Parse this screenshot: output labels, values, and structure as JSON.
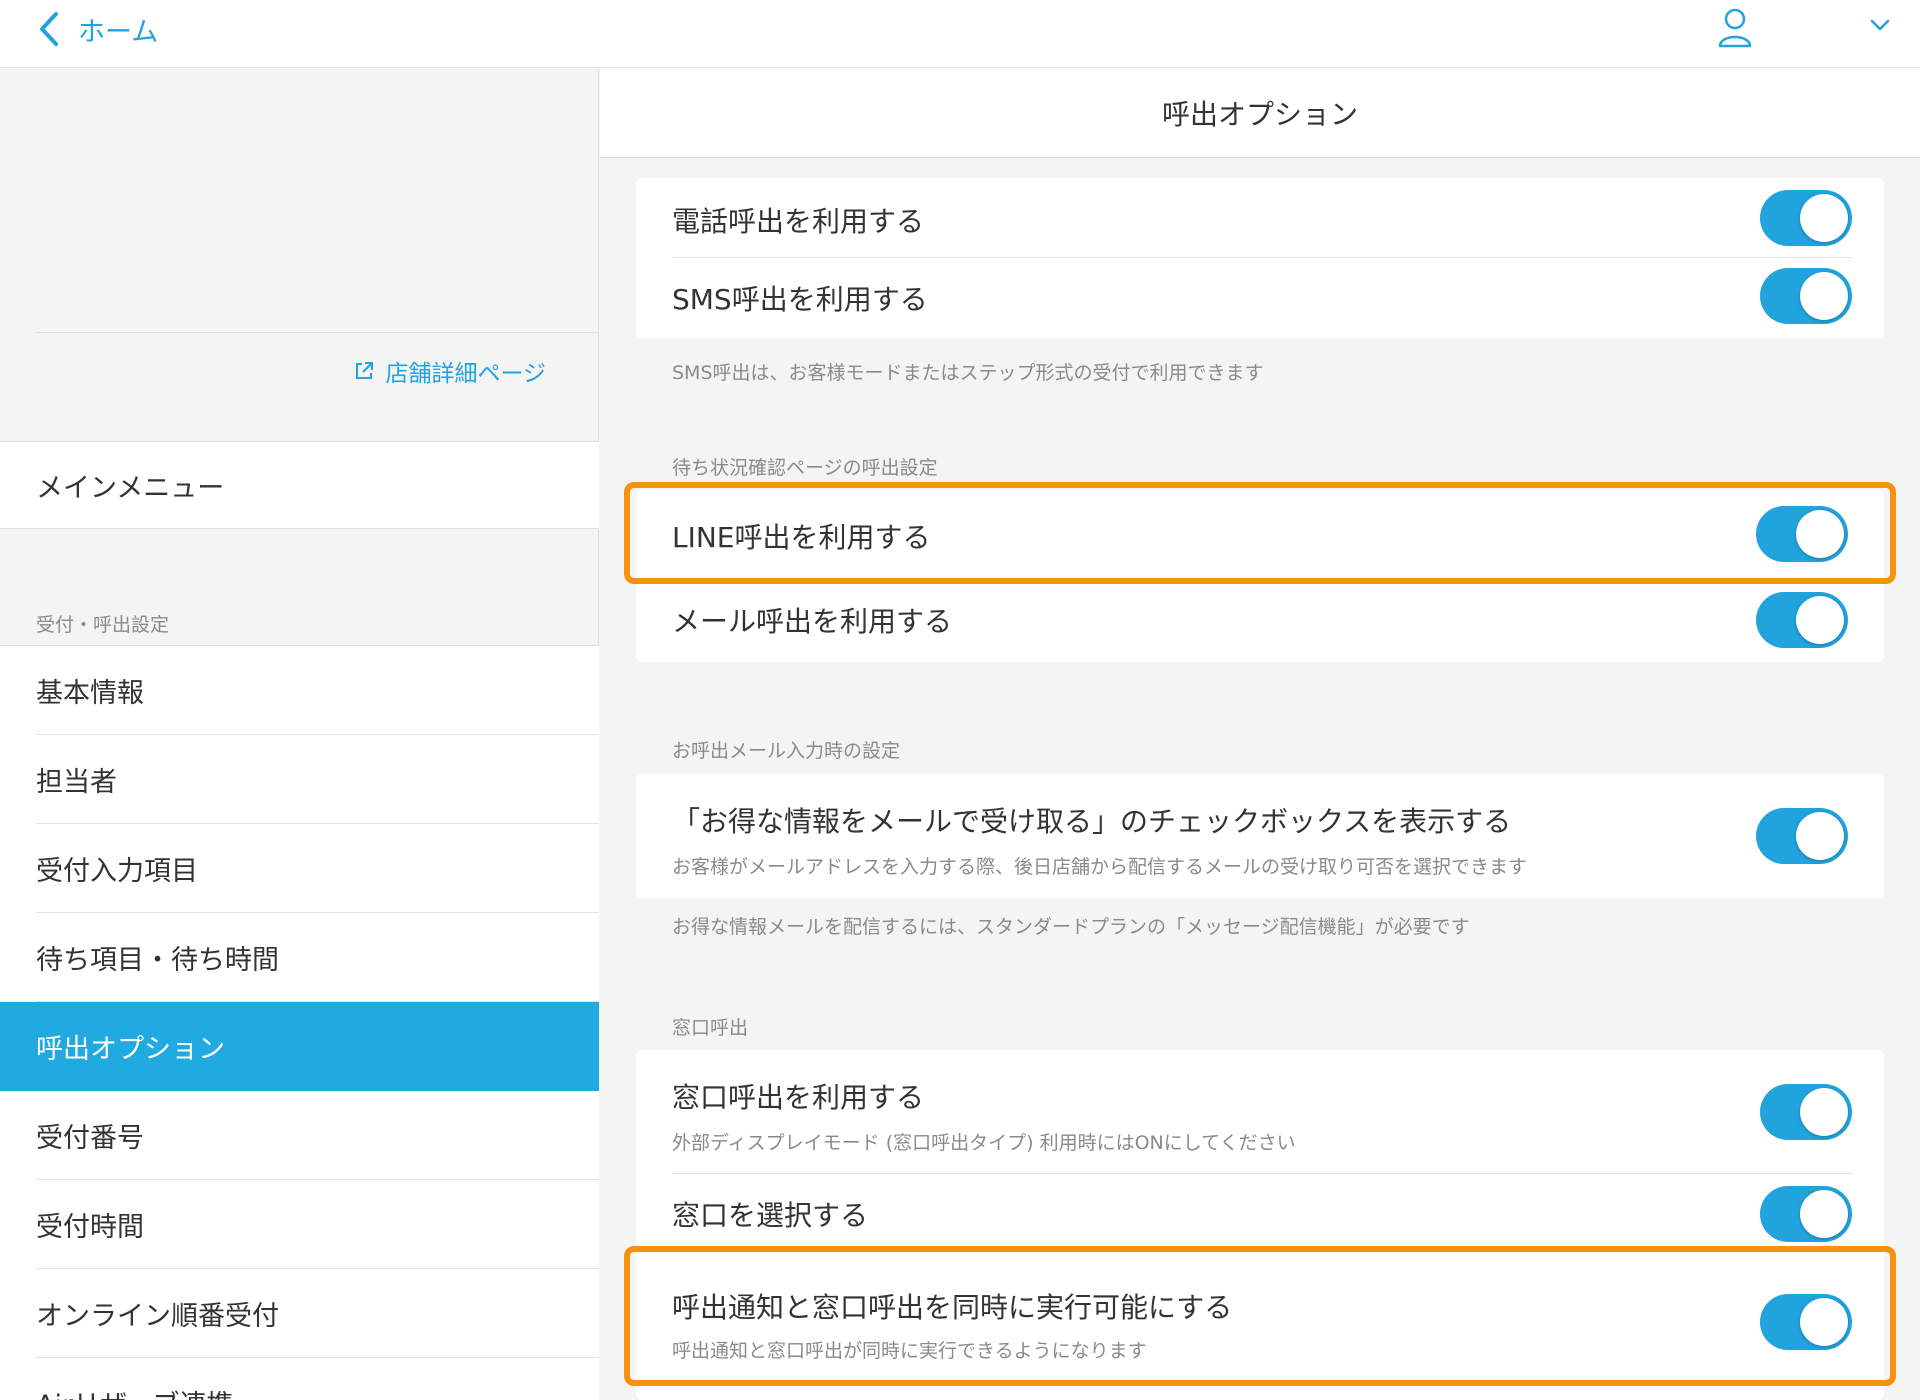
{
  "topbar": {
    "back_label": "ホーム",
    "icons": [
      "chevron-left-icon",
      "user-icon",
      "chevron-down-icon"
    ]
  },
  "sidebar": {
    "store_link": "店舗詳細ページ",
    "main_menu": "メインメニュー",
    "section_label": "受付・呼出設定",
    "items": [
      {
        "label": "基本情報"
      },
      {
        "label": "担当者"
      },
      {
        "label": "受付入力項目"
      },
      {
        "label": "待ち項目・待ち時間"
      },
      {
        "label": "呼出オプション",
        "active": true
      },
      {
        "label": "受付番号"
      },
      {
        "label": "受付時間"
      },
      {
        "label": "オンライン順番受付"
      },
      {
        "label": "Airリザーブ連携"
      }
    ]
  },
  "main": {
    "title": "呼出オプション",
    "phone_call": {
      "label": "電話呼出を利用する",
      "enabled": true
    },
    "sms_call": {
      "label": "SMS呼出を利用する",
      "enabled": true
    },
    "sms_note": "SMS呼出は、お客様モードまたはステップ形式の受付で利用できます",
    "status_page_section": "待ち状況確認ページの呼出設定",
    "line_call": {
      "label": "LINE呼出を利用する",
      "enabled": true
    },
    "mail_call": {
      "label": "メール呼出を利用する",
      "enabled": true
    },
    "mail_input_section": "お呼出メール入力時の設定",
    "deals_checkbox": {
      "label": "「お得な情報をメールで受け取る」のチェックボックスを表示する",
      "sub": "お客様がメールアドレスを入力する際、後日店舗から配信するメールの受け取り可否を選択できます",
      "enabled": true
    },
    "deals_note": "お得な情報メールを配信するには、スタンダードプランの「メッセージ配信機能」が必要です",
    "counter_section": "窓口呼出",
    "counter_call": {
      "label": "窓口呼出を利用する",
      "sub": "外部ディスプレイモード (窓口呼出タイプ) 利用時にはONにしてください",
      "enabled": true
    },
    "counter_select": {
      "label": "窓口を選択する",
      "enabled": true
    },
    "simultaneous": {
      "label": "呼出通知と窓口呼出を同時に実行可能にする",
      "sub": "呼出通知と窓口呼出が同時に実行できるようになります",
      "enabled": true
    }
  },
  "colors": {
    "accent": "#21a3dd",
    "active_bg": "#21a9e1",
    "highlight": "#f7920f"
  }
}
